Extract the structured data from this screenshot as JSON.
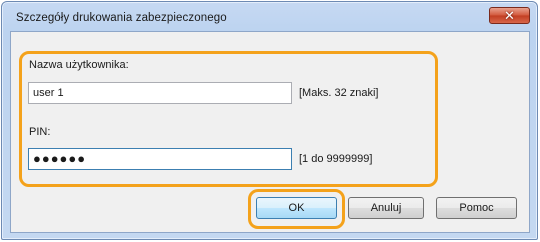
{
  "window": {
    "title": "Szczegóły drukowania zabezpieczonego",
    "close_icon": "close-icon",
    "close_glyph": "✕"
  },
  "form": {
    "username_label": "Nazwa użytkownika:",
    "username_value": "user 1",
    "username_hint": "[Maks. 32 znaki]",
    "pin_label": "PIN:",
    "pin_value": "●●●●●●",
    "pin_hint": "[1 do 9999999]"
  },
  "buttons": {
    "ok": "OK",
    "cancel": "Anuluj",
    "help": "Pomoc"
  },
  "colors": {
    "highlight": "#f4a21b",
    "close_button": "#c23e22"
  }
}
